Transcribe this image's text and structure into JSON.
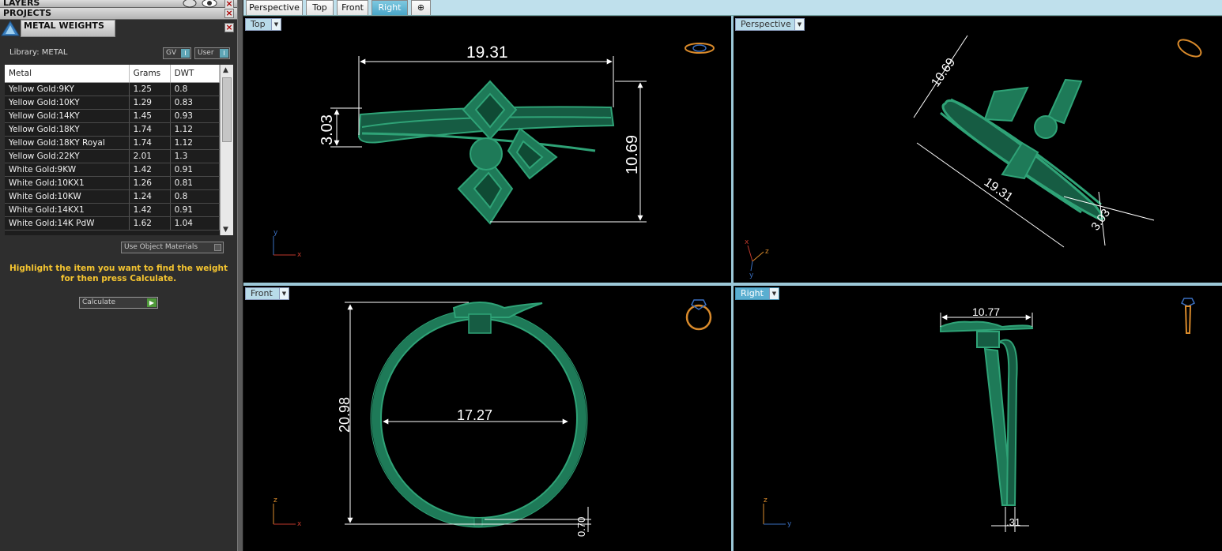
{
  "panels": {
    "layers_title": "LAYERS",
    "projects_title": "PROJECTS",
    "metal_weights_title": "METAL WEIGHTS"
  },
  "library": {
    "label": "Library: METAL",
    "gv_button": "GV",
    "user_button": "User"
  },
  "table": {
    "headers": [
      "Metal",
      "Grams",
      "DWT"
    ],
    "rows": [
      {
        "metal": "Yellow Gold:9KY",
        "grams": "1.25",
        "dwt": "0.8"
      },
      {
        "metal": "Yellow Gold:10KY",
        "grams": "1.29",
        "dwt": "0.83"
      },
      {
        "metal": "Yellow Gold:14KY",
        "grams": "1.45",
        "dwt": "0.93"
      },
      {
        "metal": "Yellow Gold:18KY",
        "grams": "1.74",
        "dwt": "1.12"
      },
      {
        "metal": "Yellow Gold:18KY Royal",
        "grams": "1.74",
        "dwt": "1.12"
      },
      {
        "metal": "Yellow Gold:22KY",
        "grams": "2.01",
        "dwt": "1.3"
      },
      {
        "metal": "White Gold:9KW",
        "grams": "1.42",
        "dwt": "0.91"
      },
      {
        "metal": "White Gold:10KX1",
        "grams": "1.26",
        "dwt": "0.81"
      },
      {
        "metal": "White Gold:10KW",
        "grams": "1.24",
        "dwt": "0.8"
      },
      {
        "metal": "White Gold:14KX1",
        "grams": "1.42",
        "dwt": "0.91"
      },
      {
        "metal": "White Gold:14K PdW",
        "grams": "1.62",
        "dwt": "1.04"
      }
    ]
  },
  "use_object_materials": "Use Object Materials",
  "hint_text": "Highlight the item you want to find the weight for then press Calculate.",
  "calculate_label": "Calculate",
  "tabs": [
    "Perspective",
    "Top",
    "Front",
    "Right"
  ],
  "active_tab": "Right",
  "add_tab_icon": "plus-icon",
  "viewports": {
    "top": {
      "label": "Top",
      "dims": {
        "width": "19.31",
        "height": "10.69",
        "thickness": "3.03"
      },
      "axes": {
        "vertical": "y",
        "horizontal": "x"
      }
    },
    "perspective": {
      "label": "Perspective",
      "dims": {
        "a": "10.69",
        "b": "19.31",
        "c": "3.03"
      },
      "axes": {
        "a": "x",
        "b": "z",
        "c": "y"
      }
    },
    "front": {
      "label": "Front",
      "dims": {
        "outer": "20.98",
        "inner": "17.27",
        "band": "0.70"
      },
      "axes": {
        "vertical": "z",
        "horizontal": "x"
      }
    },
    "right": {
      "label": "Right",
      "dims": {
        "width": "10.77",
        "band": ".31"
      },
      "axes": {
        "vertical": "z",
        "horizontal": "y"
      }
    }
  },
  "colors": {
    "model_green": "#1e7a58",
    "model_green_light": "#2fa377",
    "tab_active": "#4aa6c8",
    "hint_yellow": "#f4c430",
    "axis_x": "#c0392b",
    "axis_y": "#3a6fc0",
    "axis_z": "#d98a2b"
  }
}
